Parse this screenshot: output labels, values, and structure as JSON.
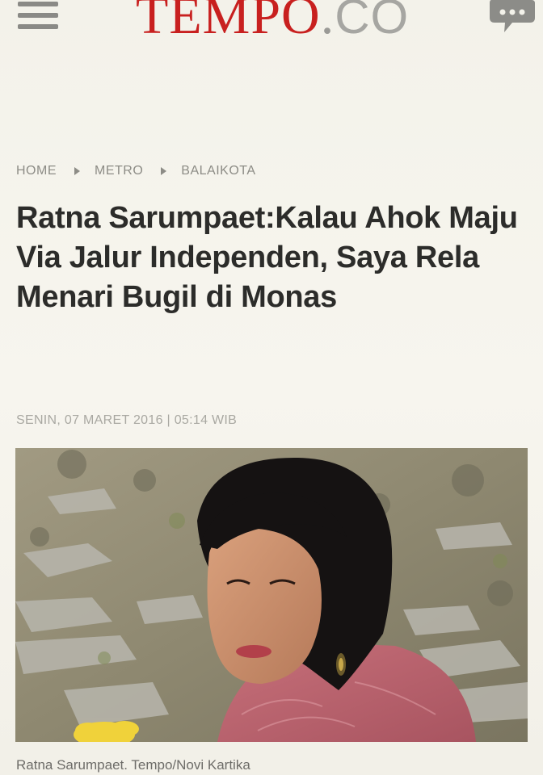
{
  "header": {
    "brand": "TEMPO",
    "brand_tld": "CO",
    "menu_icon": "hamburger-menu-icon",
    "comment_icon": "comment-bubble-icon"
  },
  "breadcrumb": {
    "items": [
      "HOME",
      "METRO",
      "BALAIKOTA"
    ],
    "separator_icon": "triangle-right-icon"
  },
  "article": {
    "title": "Ratna Sarumpaet:Kalau Ahok Maju Via Jalur Independen, Saya Rela Menari Bugil di Monas",
    "date": "SENIN, 07 MARET 2016 | 05:14 WIB",
    "photo_caption": "Ratna Sarumpaet. Tempo/Novi Kartika"
  },
  "colors": {
    "brand_red": "#c8201f",
    "text_dark": "#2c2c2a",
    "muted": "#8d8c86",
    "background": "#f5f3ec"
  }
}
